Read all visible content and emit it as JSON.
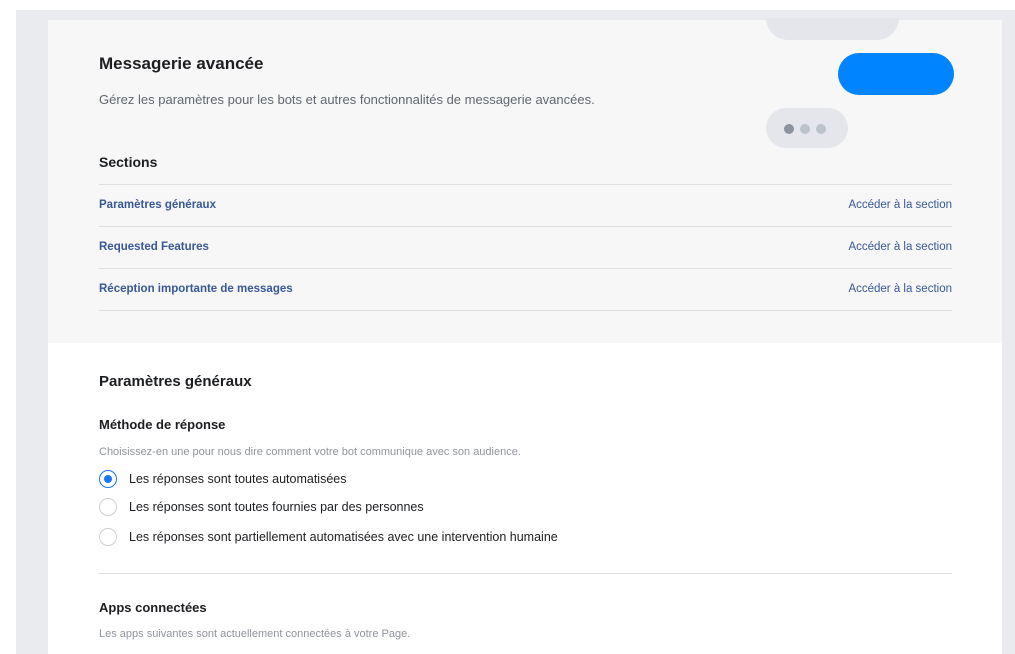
{
  "header": {
    "title": "Messagerie avancée",
    "description": "Gérez les paramètres pour les bots et autres fonctionnalités de messagerie avancées."
  },
  "sections": {
    "title": "Sections",
    "items": [
      {
        "label": "Paramètres généraux",
        "link": "Accéder à la section"
      },
      {
        "label": "Requested Features",
        "link": "Accéder à la section"
      },
      {
        "label": "Réception importante de messages",
        "link": "Accéder à la section"
      }
    ]
  },
  "general": {
    "title": "Paramètres généraux",
    "response_method": {
      "title": "Méthode de réponse",
      "description": "Choisissez-en une pour nous dire comment votre bot communique avec son audience.",
      "options": [
        {
          "label": "Les réponses sont toutes automatisées",
          "selected": true
        },
        {
          "label": "Les réponses sont toutes fournies par des personnes",
          "selected": false
        },
        {
          "label": "Les réponses sont partiellement automatisées avec une intervention humaine",
          "selected": false
        }
      ]
    },
    "connected_apps": {
      "title": "Apps connectées",
      "description": "Les apps suivantes sont actuellement connectées à votre Page."
    }
  },
  "colors": {
    "link": "#385898",
    "accent": "#0084ff",
    "radio_selected": "#1877f2"
  }
}
